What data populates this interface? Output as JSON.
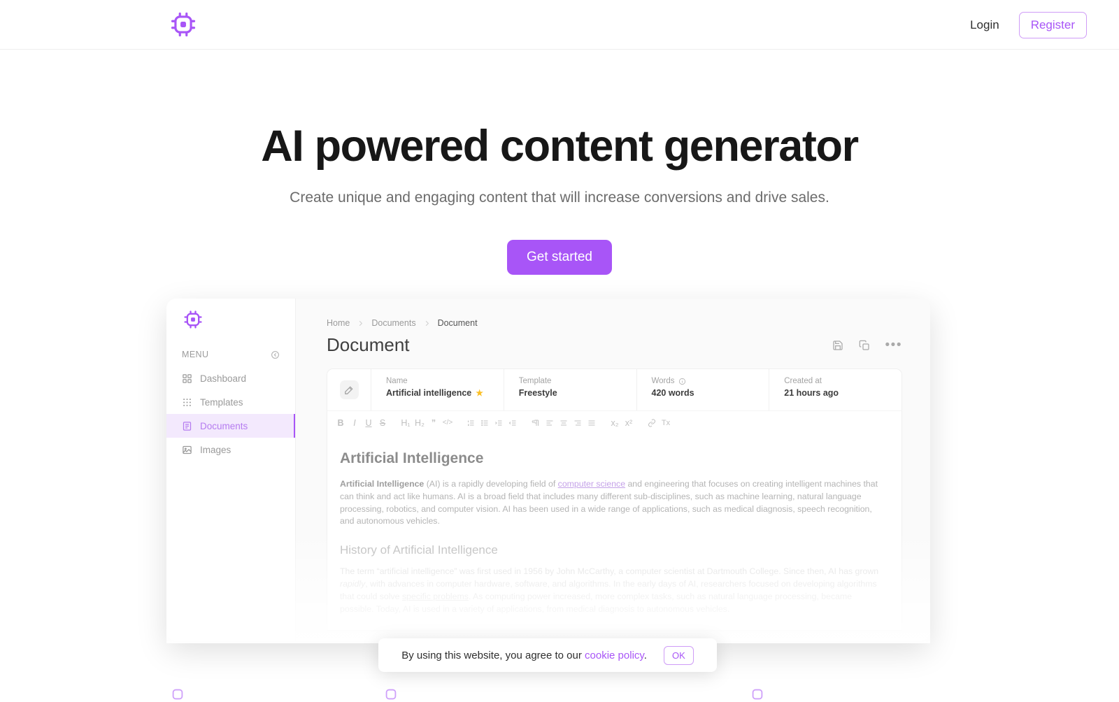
{
  "brand": {
    "logo_icon": "cpu-chip-icon",
    "accent_color": "#a855f7"
  },
  "topnav": {
    "login_label": "Login",
    "register_label": "Register"
  },
  "hero": {
    "title": "AI powered content generator",
    "subtitle": "Create unique and engaging content that will increase conversions and drive sales.",
    "cta_label": "Get started"
  },
  "app_preview": {
    "sidebar": {
      "logo_icon": "cpu-chip-icon",
      "menu_label": "MENU",
      "collapse_icon": "collapse-icon",
      "items": [
        {
          "label": "Dashboard",
          "icon": "grid-icon",
          "active": false
        },
        {
          "label": "Templates",
          "icon": "dots-grid-icon",
          "active": false
        },
        {
          "label": "Documents",
          "icon": "document-icon",
          "active": true
        },
        {
          "label": "Images",
          "icon": "image-icon",
          "active": false
        }
      ]
    },
    "breadcrumb": [
      "Home",
      "Documents",
      "Document"
    ],
    "page_title": "Document",
    "actions": [
      {
        "name": "save-icon",
        "label": "Save"
      },
      {
        "name": "copy-icon",
        "label": "Copy"
      },
      {
        "name": "more-icon",
        "label": "•••"
      }
    ],
    "meta": {
      "edit_icon": "magic-wand-icon",
      "fields": [
        {
          "key": "Name",
          "value": "Artificial intelligence",
          "starred": true
        },
        {
          "key": "Template",
          "value": "Freestyle",
          "starred": false
        },
        {
          "key": "Words",
          "value": "420 words",
          "info": true
        },
        {
          "key": "Created at",
          "value": "21 hours ago",
          "starred": false
        }
      ]
    },
    "toolbar": [
      {
        "name": "bold-icon",
        "glyph": "B"
      },
      {
        "name": "italic-icon",
        "glyph": "I"
      },
      {
        "name": "underline-icon",
        "glyph": "U"
      },
      {
        "name": "strikethrough-icon",
        "glyph": "S"
      },
      {
        "name": "heading-1-icon",
        "glyph": "H₁"
      },
      {
        "name": "heading-2-icon",
        "glyph": "H₂"
      },
      {
        "name": "blockquote-icon",
        "glyph": "”"
      },
      {
        "name": "code-block-icon",
        "glyph": "</>"
      },
      {
        "name": "ordered-list-icon",
        "glyph": "≣"
      },
      {
        "name": "bullet-list-icon",
        "glyph": "≣"
      },
      {
        "name": "indent-icon",
        "glyph": "≣"
      },
      {
        "name": "outdent-icon",
        "glyph": "≣"
      },
      {
        "name": "text-direction-icon",
        "glyph": "¶"
      },
      {
        "name": "align-left-icon",
        "glyph": "≡"
      },
      {
        "name": "align-center-icon",
        "glyph": "≡"
      },
      {
        "name": "align-right-icon",
        "glyph": "≡"
      },
      {
        "name": "align-justify-icon",
        "glyph": "≡"
      },
      {
        "name": "subscript-icon",
        "glyph": "x₂"
      },
      {
        "name": "superscript-icon",
        "glyph": "x²"
      },
      {
        "name": "link-icon",
        "glyph": "🔗"
      },
      {
        "name": "clear-format-icon",
        "glyph": "Tx"
      }
    ],
    "editor": {
      "h1": "Artificial Intelligence",
      "p1_bold": "Artificial Intelligence",
      "p1_a": " (AI) is a rapidly developing field of ",
      "p1_link": "computer science",
      "p1_b": " and engineering that focuses on creating intelligent machines that can think and act like humans. AI is a broad field that includes many different sub-disciplines, such as machine learning, natural language processing, robotics, and computer vision. AI has been used in a wide range of applications, such as medical diagnosis, speech recognition, and autonomous vehicles.",
      "h2": "History of Artificial Intelligence",
      "p2_a": "The term “artificial intelligence” was first used in 1956 by John McCarthy, a computer scientist at Dartmouth College. Since then, AI has grown ",
      "p2_em": "rapidly",
      "p2_b": ", with advances in computer hardware, software, and algorithms. In the early days of AI, researchers focused on developing algorithms that could solve ",
      "p2_u": "specific problems",
      "p2_c": ". As computing power increased, more complex tasks, such as natural language processing, became possible. Today, AI is used in a variety of applications, from medical diagnosis to autonomous vehicles."
    }
  },
  "cookie_banner": {
    "text_before": "By using this website, you agree to our ",
    "link_label": "cookie policy",
    "text_after": ".",
    "ok_label": "OK"
  }
}
